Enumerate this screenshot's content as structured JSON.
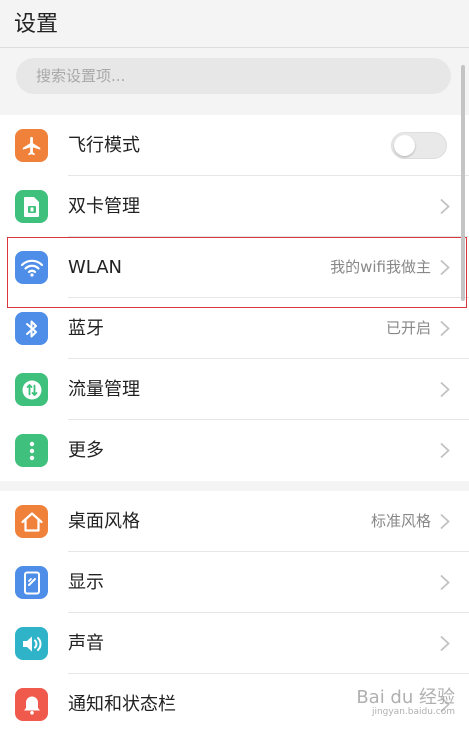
{
  "header": {
    "title": "设置"
  },
  "search": {
    "placeholder": "搜索设置项..."
  },
  "colors": {
    "orange": "#f0813a",
    "green": "#3fc07c",
    "blue": "#4f8ee8",
    "teal": "#2fb3c8",
    "red": "#f05a4d",
    "highlight": "#d9363e"
  },
  "sections": [
    {
      "items": [
        {
          "label": "飞行模式",
          "icon": "airplane-icon",
          "toggle": false
        },
        {
          "label": "双卡管理",
          "icon": "sim-card-icon"
        },
        {
          "label": "WLAN",
          "icon": "wifi-icon",
          "value": "我的wifi我做主"
        },
        {
          "label": "蓝牙",
          "icon": "bluetooth-icon",
          "value": "已开启"
        },
        {
          "label": "流量管理",
          "icon": "data-usage-icon"
        },
        {
          "label": "更多",
          "icon": "more-icon"
        }
      ]
    },
    {
      "items": [
        {
          "label": "桌面风格",
          "icon": "home-icon",
          "value": "标准风格"
        },
        {
          "label": "显示",
          "icon": "display-icon"
        },
        {
          "label": "声音",
          "icon": "sound-icon"
        },
        {
          "label": "通知和状态栏",
          "icon": "notification-icon"
        }
      ]
    }
  ],
  "watermark": {
    "main": "Bai du 经验",
    "sub": "jingyan.baidu.com"
  }
}
